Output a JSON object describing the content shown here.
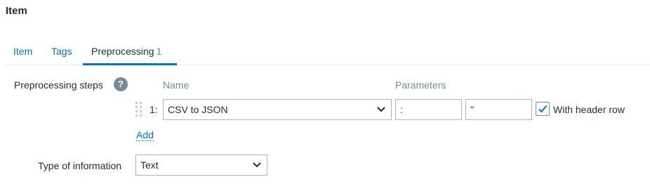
{
  "page": {
    "title": "Item"
  },
  "tabs": [
    {
      "label": "Item"
    },
    {
      "label": "Tags"
    },
    {
      "label": "Preprocessing",
      "count": "1"
    }
  ],
  "preprocessing": {
    "label": "Preprocessing steps",
    "help_icon": "?",
    "columns": {
      "name": "Name",
      "parameters": "Parameters"
    },
    "steps": [
      {
        "number": "1:",
        "name": "CSV to JSON",
        "param1": ":",
        "param2": "\"",
        "with_header_row": true,
        "header_row_label": "With header row"
      }
    ],
    "add_label": "Add"
  },
  "type_of_information": {
    "label": "Type of information",
    "value": "Text"
  },
  "colors": {
    "accent": "#0275b8",
    "text": "#1f2c33",
    "muted": "#768d99"
  }
}
